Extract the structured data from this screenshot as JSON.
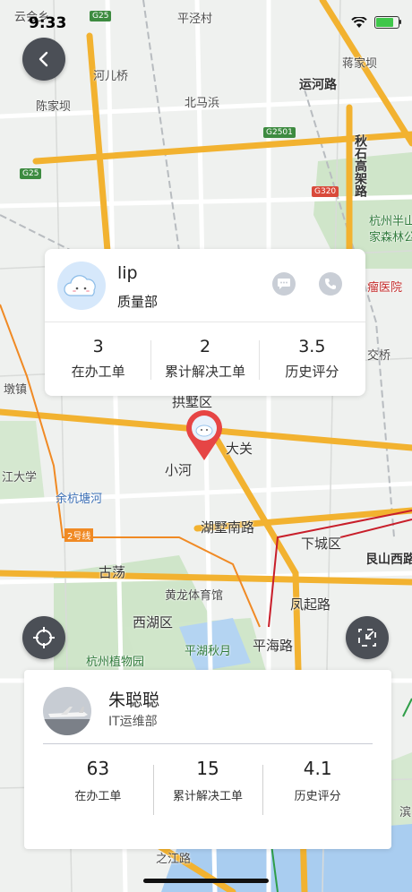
{
  "status_bar": {
    "time": "9:33"
  },
  "map": {
    "labels": {
      "yunhui": "云会乡",
      "pingjing": "平泾村",
      "hebei": "河儿桥",
      "chenjiaba": "陈家坝",
      "beimabang": "北马浜",
      "yunhe_road": "运河路",
      "jiangjiacun": "蒋家坝",
      "qiushi": "秋石高架路",
      "hangzhou_banshan": "杭州半山",
      "guojia_forest": "家森林公",
      "hospital": "瘤医院",
      "jiaoqiao": "交桥",
      "dunzhen": "墩镇",
      "gongshu": "拱墅区",
      "dadaguan": "大关",
      "xiaohe": "小河",
      "dajiao": "江大学",
      "yuhangtang": "余杭塘河",
      "line2": "2号线",
      "hushu_road": "湖墅南路",
      "xiacheng": "下城区",
      "genshan": "艮山西路",
      "gudang": "古荡",
      "huanglong": "黄龙体育馆",
      "fengqi_road": "凤起路",
      "xihu": "西湖区",
      "pinghai_road": "平海路",
      "pinghu": "平湖秋月",
      "zhiwuyuan": "杭州植物园",
      "zhijiang_road": "之江路",
      "bin": "滨"
    },
    "shields": {
      "g25_top": "G25",
      "g2501": "G2501",
      "g25_left": "G25",
      "g320": "G320"
    }
  },
  "buttons": {
    "back": "back",
    "locate": "locate",
    "collapse": "collapse"
  },
  "top_card": {
    "name": "lip",
    "dept": "质量部",
    "stats": [
      {
        "value": "3",
        "label": "在办工单"
      },
      {
        "value": "2",
        "label": "累计解决工单"
      },
      {
        "value": "3.5",
        "label": "历史评分"
      }
    ]
  },
  "bottom_card": {
    "name": "朱聪聪",
    "dept": "IT运维部",
    "stats": [
      {
        "value": "63",
        "label": "在办工单"
      },
      {
        "value": "15",
        "label": "累计解决工单"
      },
      {
        "value": "4.1",
        "label": "历史评分"
      }
    ]
  },
  "colors": {
    "accent_pin": "#e64545",
    "button_bg": "#4b4f56",
    "road_yellow": "#f2b230"
  }
}
